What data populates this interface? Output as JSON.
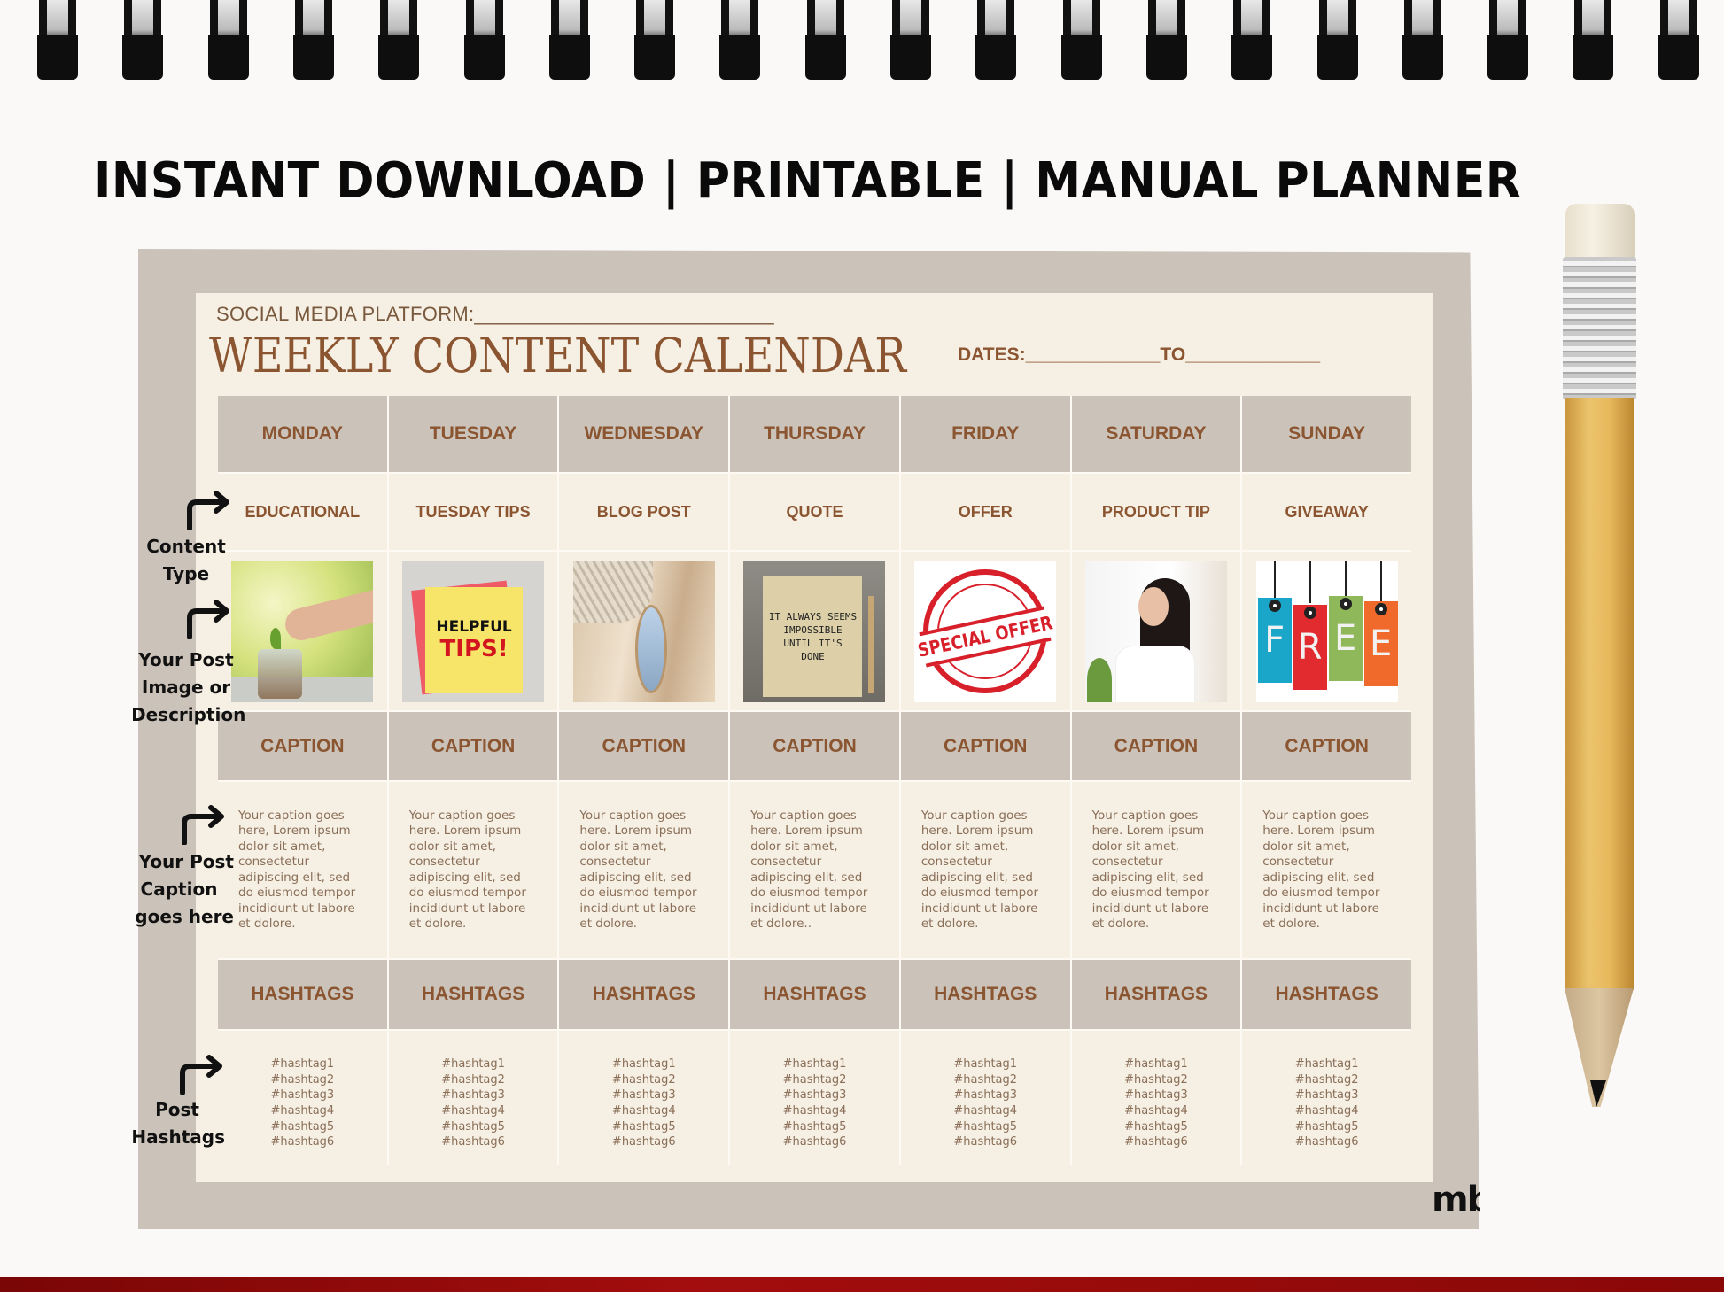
{
  "headline": "INSTANT DOWNLOAD | PRINTABLE | MANUAL PLANNER",
  "planner": {
    "platform_label": "SOCIAL MEDIA PLATFORM:___________________________",
    "title": "WEEKLY CONTENT CALENDAR",
    "dates_label": "DATES:_____________TO_____________",
    "days": [
      {
        "day": "MONDAY",
        "content_type": "EDUCATIONAL",
        "image": "plant-coin-jar-image",
        "caption_header": "CAPTION",
        "caption": "Your caption goes here, Lorem ipsum dolor sit amet, consectetur adipiscing elit, sed do eiusmod tempor incididunt ut labore et dolore.",
        "hashtags_header": "HASHTAGS",
        "hashtags": [
          "#hashtag1",
          "#hashtag2",
          "#hashtag3",
          "#hashtag4",
          "#hashtag5",
          "#hashtag6"
        ]
      },
      {
        "day": "TUESDAY",
        "content_type": "TUESDAY TIPS",
        "image": "helpful-tips-note-image",
        "image_text": [
          "HELPFUL",
          "TIPS!"
        ],
        "caption_header": "CAPTION",
        "caption": "Your caption goes here. Lorem ipsum dolor sit amet, consectetur adipiscing elit, sed do eiusmod tempor incididunt ut labore et dolore.",
        "hashtags_header": "HASHTAGS",
        "hashtags": [
          "#hashtag1",
          "#hashtag2",
          "#hashtag3",
          "#hashtag4",
          "#hashtag5",
          "#hashtag6"
        ]
      },
      {
        "day": "WEDNESDAY",
        "content_type": "BLOG POST",
        "image": "hand-mirror-image",
        "caption_header": "CAPTION",
        "caption": "Your caption goes here. Lorem ipsum dolor sit amet, consectetur adipiscing elit, sed do eiusmod tempor incididunt ut labore et dolore.",
        "hashtags_header": "HASHTAGS",
        "hashtags": [
          "#hashtag1",
          "#hashtag2",
          "#hashtag3",
          "#hashtag4",
          "#hashtag5",
          "#hashtag6"
        ]
      },
      {
        "day": "THURSDAY",
        "content_type": "QUOTE",
        "image": "quote-card-image",
        "image_text": [
          "IT ALWAYS SEEMS",
          "IMPOSSIBLE",
          "UNTIL IT'S",
          "DONE"
        ],
        "caption_header": "CAPTION",
        "caption": "Your caption goes here. Lorem ipsum dolor sit amet, consectetur adipiscing elit, sed do eiusmod tempor incididunt ut labore et dolore..",
        "hashtags_header": "HASHTAGS",
        "hashtags": [
          "#hashtag1",
          "#hashtag2",
          "#hashtag3",
          "#hashtag4",
          "#hashtag5",
          "#hashtag6"
        ]
      },
      {
        "day": "FRIDAY",
        "content_type": "OFFER",
        "image": "special-offer-stamp-image",
        "image_text": [
          "SPECIAL OFFER"
        ],
        "caption_header": "CAPTION",
        "caption": "Your caption goes here. Lorem ipsum dolor sit amet, consectetur adipiscing elit, sed do eiusmod tempor incididunt ut labore et dolore.",
        "hashtags_header": "HASHTAGS",
        "hashtags": [
          "#hashtag1",
          "#hashtag2",
          "#hashtag3",
          "#hashtag4",
          "#hashtag5",
          "#hashtag6"
        ]
      },
      {
        "day": "SATURDAY",
        "content_type": "PRODUCT TIP",
        "image": "woman-hair-spray-image",
        "caption_header": "CAPTION",
        "caption": "Your caption goes here. Lorem ipsum dolor sit amet, consectetur adipiscing elit, sed do eiusmod tempor incididunt ut labore et dolore.",
        "hashtags_header": "HASHTAGS",
        "hashtags": [
          "#hashtag1",
          "#hashtag2",
          "#hashtag3",
          "#hashtag4",
          "#hashtag5",
          "#hashtag6"
        ]
      },
      {
        "day": "SUNDAY",
        "content_type": "GIVEAWAY",
        "image": "free-tags-image",
        "image_text": [
          "F",
          "R",
          "E",
          "E"
        ],
        "caption_header": "CAPTION",
        "caption": "Your caption goes here. Lorem ipsum dolor sit amet, consectetur adipiscing elit, sed do eiusmod tempor incididunt ut labore et dolore.",
        "hashtags_header": "HASHTAGS",
        "hashtags": [
          "#hashtag1",
          "#hashtag2",
          "#hashtag3",
          "#hashtag4",
          "#hashtag5",
          "#hashtag6"
        ]
      }
    ]
  },
  "annotations": [
    {
      "id": "content-type",
      "lines": [
        "Content",
        "Type"
      ]
    },
    {
      "id": "post-image",
      "lines": [
        "Your Post",
        "Image or",
        "Description"
      ]
    },
    {
      "id": "post-caption",
      "lines": [
        "Your Post",
        "Caption",
        "goes here"
      ]
    },
    {
      "id": "post-hashtags",
      "lines": [
        "Post",
        "Hashtags"
      ]
    }
  ],
  "logo": {
    "text": "mb",
    "accent": "#34b44a"
  },
  "colors": {
    "frame": "#cbc3b9",
    "panel": "#f6efe3",
    "brown_text": "#8a5530",
    "body_text": "#8a6f58",
    "free_tags": [
      "#1aa6c9",
      "#e22b2f",
      "#8fb85a",
      "#ef6a2b"
    ]
  }
}
